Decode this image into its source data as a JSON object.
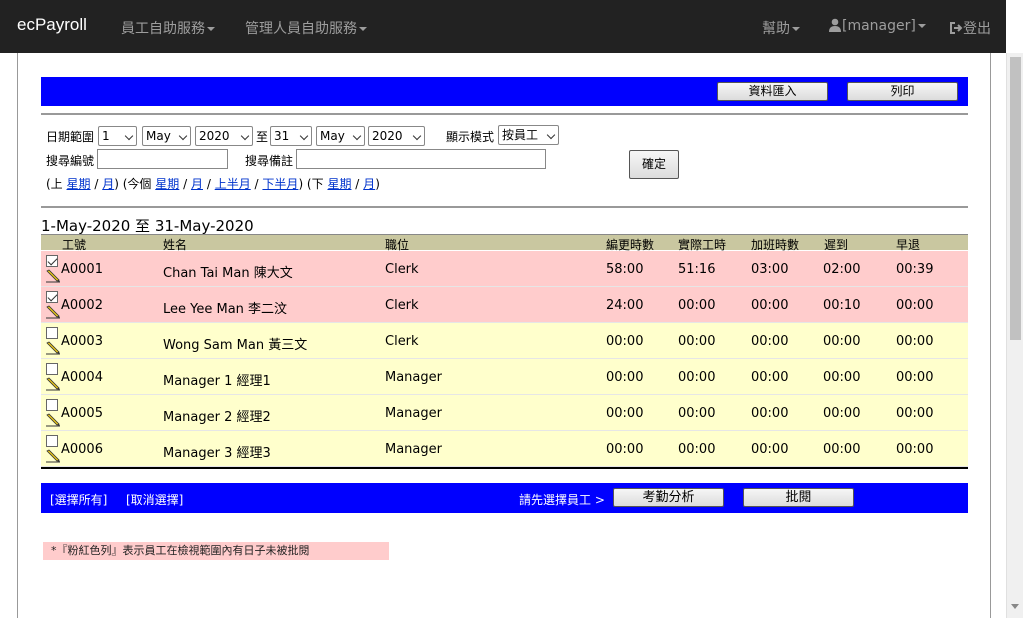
{
  "navbar": {
    "brand": "ecPayroll",
    "menu_employee": "員工自助服務",
    "menu_manager": "管理人員自助服務",
    "help": "幫助",
    "user": "[manager]",
    "logout": "登出"
  },
  "toolbar": {
    "export_label": "資料匯入",
    "print_label": "列印"
  },
  "filters": {
    "date_range_label": "日期範圍",
    "from_day": "1",
    "from_month": "May",
    "from_year": "2020",
    "to_label": "至",
    "to_day": "31",
    "to_month": "May",
    "to_year": "2020",
    "display_mode_label": "顯示模式",
    "display_mode": "按員工",
    "search_id_label": "搜尋編號",
    "search_id_value": "",
    "search_note_label": "搜尋備註",
    "search_note_value": "",
    "confirm_label": "確定",
    "quick": {
      "prev_open": "(上",
      "week": "星期",
      "slash": "/",
      "month": "月",
      "close_open_this": ") (今個",
      "first_half": "上半月",
      "second_half": "下半月",
      "close_open_next": ") (下",
      "close": ")"
    }
  },
  "range_title": "1-May-2020 至 31-May-2020",
  "table": {
    "headers": [
      "工號",
      "姓名",
      "職位",
      "編更時數",
      "實際工時",
      "加班時數",
      "遲到",
      "早退"
    ],
    "rows": [
      {
        "checked": true,
        "status": "pink",
        "id": "A0001",
        "name": "Chan Tai Man 陳大文",
        "position": "Clerk",
        "scheduled": "58:00",
        "actual": "51:16",
        "overtime": "03:00",
        "late": "02:00",
        "early": "00:39"
      },
      {
        "checked": true,
        "status": "pink",
        "id": "A0002",
        "name": "Lee Yee Man 李二汶",
        "position": "Clerk",
        "scheduled": "24:00",
        "actual": "00:00",
        "overtime": "00:00",
        "late": "00:10",
        "early": "00:00"
      },
      {
        "checked": false,
        "status": "yellow",
        "id": "A0003",
        "name": "Wong Sam Man 黃三文",
        "position": "Clerk",
        "scheduled": "00:00",
        "actual": "00:00",
        "overtime": "00:00",
        "late": "00:00",
        "early": "00:00"
      },
      {
        "checked": false,
        "status": "yellow",
        "id": "A0004",
        "name": "Manager 1 經理1",
        "position": "Manager",
        "scheduled": "00:00",
        "actual": "00:00",
        "overtime": "00:00",
        "late": "00:00",
        "early": "00:00"
      },
      {
        "checked": false,
        "status": "yellow",
        "id": "A0005",
        "name": "Manager 2 經理2",
        "position": "Manager",
        "scheduled": "00:00",
        "actual": "00:00",
        "overtime": "00:00",
        "late": "00:00",
        "early": "00:00"
      },
      {
        "checked": false,
        "status": "yellow",
        "id": "A0006",
        "name": "Manager 3 經理3",
        "position": "Manager",
        "scheduled": "00:00",
        "actual": "00:00",
        "overtime": "00:00",
        "late": "00:00",
        "early": "00:00"
      }
    ]
  },
  "bottom": {
    "select_all": "[選擇所有]",
    "deselect": "[取消選擇]",
    "prompt": "請先選擇員工 >",
    "analyze_label": "考勤分析",
    "approve_label": "批閱"
  },
  "note": "*『粉紅色列』表示員工在檢視範圍內有日子未被批閱",
  "colors": {
    "navbar": "#222222",
    "bluebar": "#0000ff",
    "pink_row": "#ffcccc",
    "yellow_row": "#ffffcc",
    "header": "#c9c7a0"
  }
}
